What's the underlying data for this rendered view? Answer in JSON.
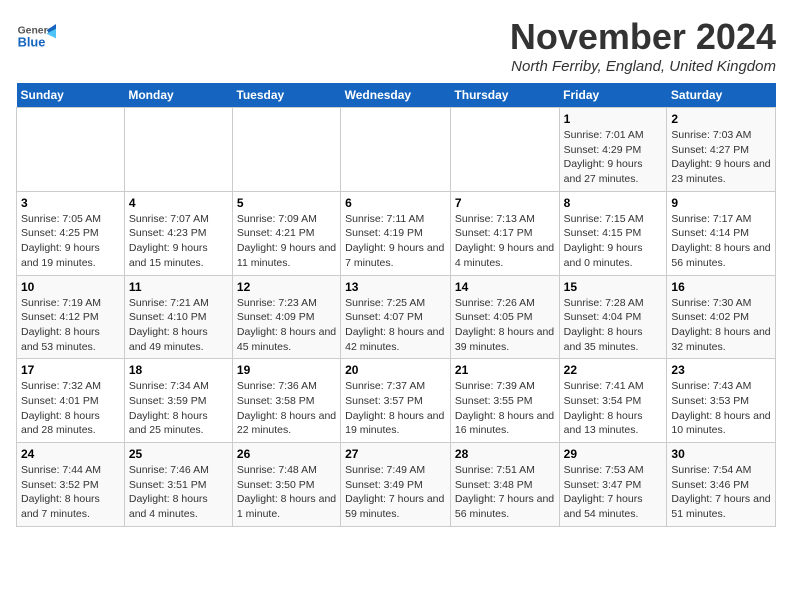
{
  "header": {
    "logo_general": "General",
    "logo_blue": "Blue",
    "month_title": "November 2024",
    "location": "North Ferriby, England, United Kingdom"
  },
  "days_of_week": [
    "Sunday",
    "Monday",
    "Tuesday",
    "Wednesday",
    "Thursday",
    "Friday",
    "Saturday"
  ],
  "weeks": [
    [
      {
        "day": "",
        "info": ""
      },
      {
        "day": "",
        "info": ""
      },
      {
        "day": "",
        "info": ""
      },
      {
        "day": "",
        "info": ""
      },
      {
        "day": "",
        "info": ""
      },
      {
        "day": "1",
        "info": "Sunrise: 7:01 AM\nSunset: 4:29 PM\nDaylight: 9 hours and 27 minutes."
      },
      {
        "day": "2",
        "info": "Sunrise: 7:03 AM\nSunset: 4:27 PM\nDaylight: 9 hours and 23 minutes."
      }
    ],
    [
      {
        "day": "3",
        "info": "Sunrise: 7:05 AM\nSunset: 4:25 PM\nDaylight: 9 hours and 19 minutes."
      },
      {
        "day": "4",
        "info": "Sunrise: 7:07 AM\nSunset: 4:23 PM\nDaylight: 9 hours and 15 minutes."
      },
      {
        "day": "5",
        "info": "Sunrise: 7:09 AM\nSunset: 4:21 PM\nDaylight: 9 hours and 11 minutes."
      },
      {
        "day": "6",
        "info": "Sunrise: 7:11 AM\nSunset: 4:19 PM\nDaylight: 9 hours and 7 minutes."
      },
      {
        "day": "7",
        "info": "Sunrise: 7:13 AM\nSunset: 4:17 PM\nDaylight: 9 hours and 4 minutes."
      },
      {
        "day": "8",
        "info": "Sunrise: 7:15 AM\nSunset: 4:15 PM\nDaylight: 9 hours and 0 minutes."
      },
      {
        "day": "9",
        "info": "Sunrise: 7:17 AM\nSunset: 4:14 PM\nDaylight: 8 hours and 56 minutes."
      }
    ],
    [
      {
        "day": "10",
        "info": "Sunrise: 7:19 AM\nSunset: 4:12 PM\nDaylight: 8 hours and 53 minutes."
      },
      {
        "day": "11",
        "info": "Sunrise: 7:21 AM\nSunset: 4:10 PM\nDaylight: 8 hours and 49 minutes."
      },
      {
        "day": "12",
        "info": "Sunrise: 7:23 AM\nSunset: 4:09 PM\nDaylight: 8 hours and 45 minutes."
      },
      {
        "day": "13",
        "info": "Sunrise: 7:25 AM\nSunset: 4:07 PM\nDaylight: 8 hours and 42 minutes."
      },
      {
        "day": "14",
        "info": "Sunrise: 7:26 AM\nSunset: 4:05 PM\nDaylight: 8 hours and 39 minutes."
      },
      {
        "day": "15",
        "info": "Sunrise: 7:28 AM\nSunset: 4:04 PM\nDaylight: 8 hours and 35 minutes."
      },
      {
        "day": "16",
        "info": "Sunrise: 7:30 AM\nSunset: 4:02 PM\nDaylight: 8 hours and 32 minutes."
      }
    ],
    [
      {
        "day": "17",
        "info": "Sunrise: 7:32 AM\nSunset: 4:01 PM\nDaylight: 8 hours and 28 minutes."
      },
      {
        "day": "18",
        "info": "Sunrise: 7:34 AM\nSunset: 3:59 PM\nDaylight: 8 hours and 25 minutes."
      },
      {
        "day": "19",
        "info": "Sunrise: 7:36 AM\nSunset: 3:58 PM\nDaylight: 8 hours and 22 minutes."
      },
      {
        "day": "20",
        "info": "Sunrise: 7:37 AM\nSunset: 3:57 PM\nDaylight: 8 hours and 19 minutes."
      },
      {
        "day": "21",
        "info": "Sunrise: 7:39 AM\nSunset: 3:55 PM\nDaylight: 8 hours and 16 minutes."
      },
      {
        "day": "22",
        "info": "Sunrise: 7:41 AM\nSunset: 3:54 PM\nDaylight: 8 hours and 13 minutes."
      },
      {
        "day": "23",
        "info": "Sunrise: 7:43 AM\nSunset: 3:53 PM\nDaylight: 8 hours and 10 minutes."
      }
    ],
    [
      {
        "day": "24",
        "info": "Sunrise: 7:44 AM\nSunset: 3:52 PM\nDaylight: 8 hours and 7 minutes."
      },
      {
        "day": "25",
        "info": "Sunrise: 7:46 AM\nSunset: 3:51 PM\nDaylight: 8 hours and 4 minutes."
      },
      {
        "day": "26",
        "info": "Sunrise: 7:48 AM\nSunset: 3:50 PM\nDaylight: 8 hours and 1 minute."
      },
      {
        "day": "27",
        "info": "Sunrise: 7:49 AM\nSunset: 3:49 PM\nDaylight: 7 hours and 59 minutes."
      },
      {
        "day": "28",
        "info": "Sunrise: 7:51 AM\nSunset: 3:48 PM\nDaylight: 7 hours and 56 minutes."
      },
      {
        "day": "29",
        "info": "Sunrise: 7:53 AM\nSunset: 3:47 PM\nDaylight: 7 hours and 54 minutes."
      },
      {
        "day": "30",
        "info": "Sunrise: 7:54 AM\nSunset: 3:46 PM\nDaylight: 7 hours and 51 minutes."
      }
    ]
  ]
}
